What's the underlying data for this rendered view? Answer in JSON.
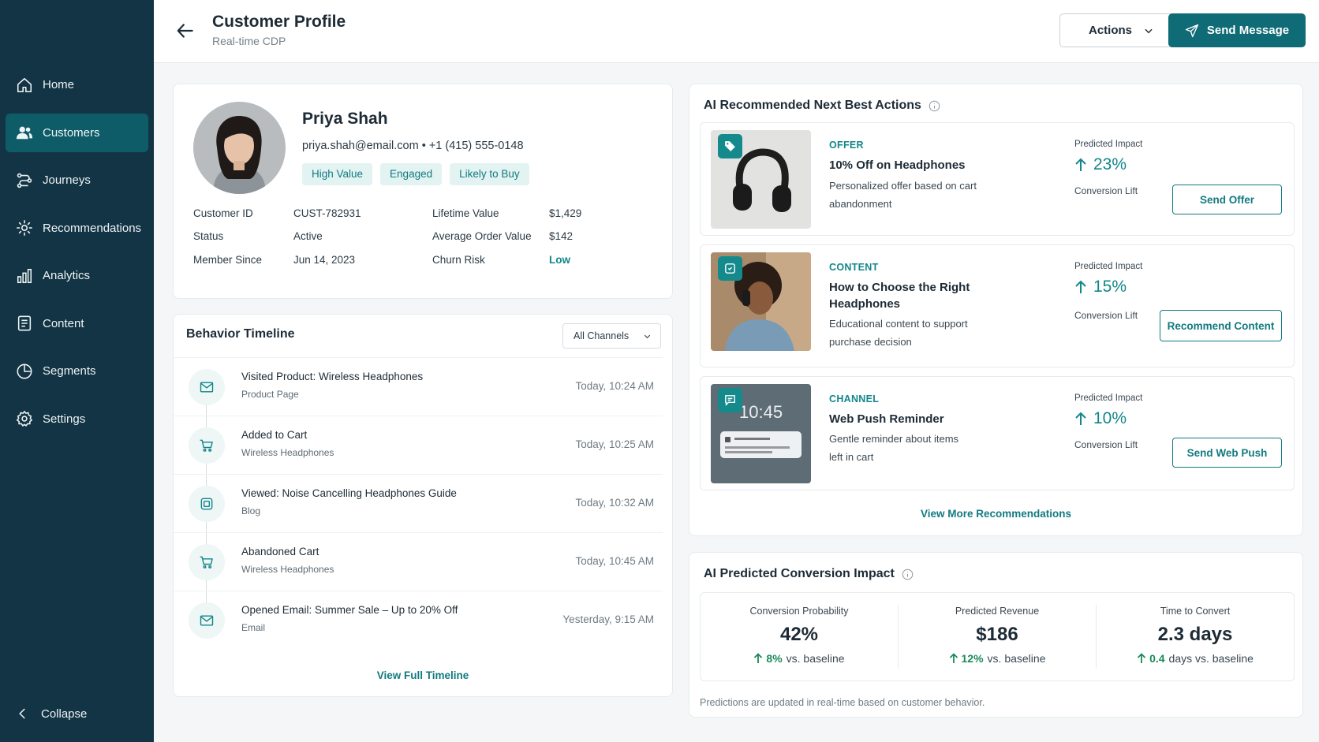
{
  "sidebar": {
    "items": [
      {
        "label": "Home",
        "icon": "home-icon"
      },
      {
        "label": "Customers",
        "icon": "users-icon",
        "active": true
      },
      {
        "label": "Journeys",
        "icon": "journeys-icon"
      },
      {
        "label": "Recommendations",
        "icon": "sparkle-icon"
      },
      {
        "label": "Analytics",
        "icon": "bar-chart-icon"
      },
      {
        "label": "Content",
        "icon": "document-icon"
      },
      {
        "label": "Segments",
        "icon": "pie-icon"
      },
      {
        "label": "Settings",
        "icon": "gear-icon"
      }
    ],
    "collapse_label": "Collapse"
  },
  "header": {
    "title": "Customer Profile",
    "subtitle": "Real-time CDP",
    "actions_label": "Actions",
    "send_label": "Send Message"
  },
  "profile": {
    "name": "Priya Shah",
    "contact": "priya.shah@email.com  •  +1 (415) 555-0148",
    "tags": [
      "High Value",
      "Engaged",
      "Likely to Buy"
    ],
    "fields": {
      "customer_id_label": "Customer ID",
      "customer_id": "CUST-782931",
      "status_label": "Status",
      "status": "Active",
      "member_since_label": "Member Since",
      "member_since": "Jun 14, 2023",
      "lifetime_value_label": "Lifetime Value",
      "lifetime_value": "$1,429",
      "aov_label": "Average Order Value",
      "aov": "$142",
      "churn_label": "Churn Risk",
      "churn": "Low"
    }
  },
  "timeline": {
    "title": "Behavior Timeline",
    "filter": "All Channels",
    "events": [
      {
        "label": "Visited Product: Wireless Headphones",
        "sub": "Product Page",
        "time": "Today, 10:24 AM",
        "icon": "mail-icon"
      },
      {
        "label": "Added to Cart",
        "sub": "Wireless Headphones",
        "time": "Today, 10:25 AM",
        "icon": "cart-icon"
      },
      {
        "label": "Viewed: Noise Cancelling Headphones Guide",
        "sub": "Blog",
        "time": "Today, 10:32 AM",
        "icon": "content-icon"
      },
      {
        "label": "Abandoned Cart",
        "sub": "Wireless Headphones",
        "time": "Today, 10:45 AM",
        "icon": "cart-icon"
      },
      {
        "label": "Opened Email: Summer Sale – Up to 20% Off",
        "sub": "Email",
        "time": "Yesterday, 9:15 AM",
        "icon": "mail-icon"
      }
    ],
    "link": "View Full Timeline"
  },
  "recommendations": {
    "title": "AI Recommended Next Best Actions",
    "items": [
      {
        "type": "OFFER",
        "title": "10% Off on Headphones",
        "desc": "Personalized offer based on cart abandonment",
        "impact_label": "Predicted Impact",
        "impact": "23%",
        "impact_sub": "Conversion Lift",
        "button": "Send Offer",
        "badge_icon": "tag-icon"
      },
      {
        "type": "CONTENT",
        "title": "How to Choose the Right Headphones",
        "desc": "Educational content to support purchase decision",
        "impact_label": "Predicted Impact",
        "impact": "15%",
        "impact_sub": "Conversion Lift",
        "button": "Recommend Content",
        "badge_icon": "content-icon"
      },
      {
        "type": "CHANNEL",
        "title": "Web Push Reminder",
        "desc": "Gentle reminder about items left in cart",
        "impact_label": "Predicted Impact",
        "impact": "10%",
        "impact_sub": "Conversion Lift",
        "button": "Send Web Push",
        "badge_icon": "chat-icon",
        "image_time": "10:45"
      }
    ],
    "link": "View More Recommendations"
  },
  "impact": {
    "title": "AI Predicted Conversion Impact",
    "stats": [
      {
        "label": "Conversion Probability",
        "value": "42%",
        "delta": "8%",
        "delta_text": "vs. baseline"
      },
      {
        "label": "Predicted Revenue",
        "value": "$186",
        "delta": "12%",
        "delta_text": "vs. baseline"
      },
      {
        "label": "Time to Convert",
        "value": "2.3 days",
        "delta": "0.4",
        "delta_text": "days vs. baseline"
      }
    ],
    "note": "Predictions are updated in real-time based on customer behavior."
  },
  "colors": {
    "sidebar": "#133444",
    "accent": "#0f6b75",
    "teal_text": "#127a80",
    "positive": "#1a8a5a"
  }
}
